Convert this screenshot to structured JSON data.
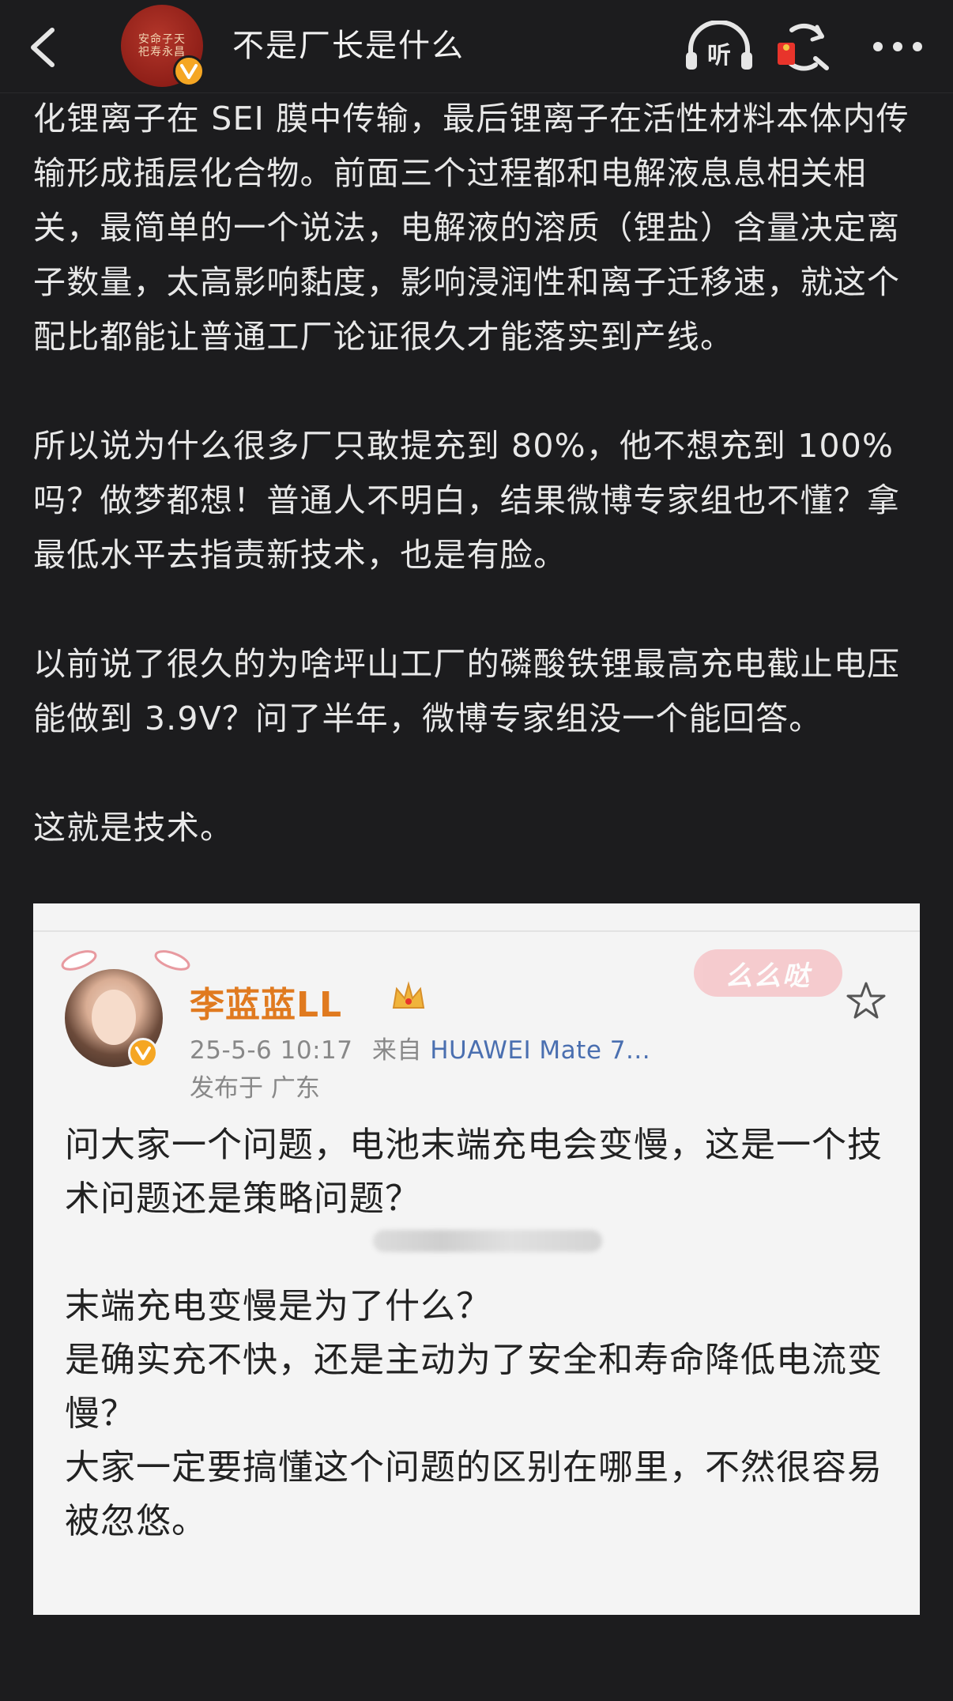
{
  "header": {
    "title": "不是厂长是什么",
    "avatar_text": "安命子天\n祀寿永昌",
    "icons": [
      "back-icon",
      "listen-icon",
      "red-packet-icon",
      "more-icon"
    ],
    "listen_label": "听"
  },
  "post": {
    "paragraphs": [
      "化锂离子在 SEI 膜中传输，最后锂离子在活性材料本体内传输形成插层化合物。前面三个过程都和电解液息息相关相关，最简单的一个说法，电解液的溶质（锂盐）含量决定离子数量，太高影响黏度，影响浸润性和离子迁移速，就这个配比都能让普通工厂论证很久才能落实到产线。",
      "所以说为什么很多厂只敢提充到 80%，他不想充到 100% 吗？做梦都想！普通人不明白，结果微博专家组也不懂？拿最低水平去指责新技术，也是有脸。",
      "以前说了很久的为啥坪山工厂的磷酸铁锂最高充电截止电压能做到 3.9V？问了半年，微博专家组没一个能回答。",
      "这就是技术。"
    ]
  },
  "quoted": {
    "author": "李蓝蓝LL",
    "time": "25-5-6 10:17",
    "from_label": "来自",
    "device": "HUAWEI Mate 7...",
    "location": "发布于 广东",
    "sticker": "么么哒",
    "lines": [
      "问大家一个问题，电池末端充电会变慢，这是一个技术问题还是策略问题？",
      "末端充电变慢是为了什么？\n是确实充不快，还是主动为了安全和寿命降低电流变慢？\n大家一定要搞懂这个问题的区别在哪里，不然很容易被忽悠。"
    ]
  },
  "colors": {
    "background": "#1c1c1e",
    "text": "#e8e8e8",
    "verified": "#f5a623",
    "quote_name": "#e07a1f",
    "device_link": "#4a6fb0"
  }
}
